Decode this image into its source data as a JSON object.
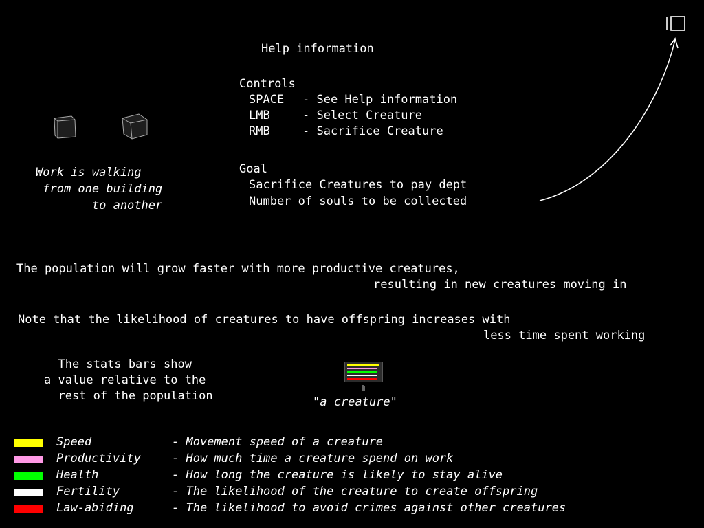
{
  "help": {
    "title": "Help information",
    "controls_heading": "Controls",
    "controls": [
      {
        "key": "SPACE",
        "desc": "- See Help information"
      },
      {
        "key": "LMB",
        "desc": "- Select Creature"
      },
      {
        "key": "RMB",
        "desc": "- Sacrifice Creature"
      }
    ],
    "goal_heading": "Goal",
    "goal_lines": [
      "Sacrifice Creatures to pay dept",
      "Number of souls to be collected"
    ]
  },
  "work_note": {
    "lines": [
      "Work is walking",
      " from one building",
      "        to another"
    ]
  },
  "population": {
    "line1": "The population will grow faster with more productive creatures,",
    "line2": "resulting in new creatures moving in"
  },
  "offspring_note": {
    "line1": "Note that the likelihood of creatures to have offspring increases with",
    "line2": "less time spent working"
  },
  "stats_note": {
    "lines": [
      "  The stats bars show",
      "a value relative to the",
      "  rest of the population"
    ]
  },
  "creature_label": "\"a creature\"",
  "legend": [
    {
      "name": "Speed",
      "desc": "- Movement speed of a creature",
      "color": "#ffff00"
    },
    {
      "name": "Productivity",
      "desc": "- How much time a creature spend on work",
      "color": "#ff99e6"
    },
    {
      "name": "Health",
      "desc": "- How long the creature is likely to stay alive",
      "color": "#00ff00"
    },
    {
      "name": "Fertility",
      "desc": "- The likelihood of the creature to create offspring",
      "color": "#ffffff"
    },
    {
      "name": "Law-abiding",
      "desc": "- The likelihood to avoid crimes against other creatures",
      "color": "#ff0000"
    }
  ],
  "creature_bars": [
    {
      "stat": "Speed",
      "value": 0.95,
      "color": "#ffff00"
    },
    {
      "stat": "Productivity",
      "value": 0.9,
      "color": "#ff99e6"
    },
    {
      "stat": "Health",
      "value": 0.9,
      "color": "#00ff00"
    },
    {
      "stat": "Fertility",
      "value": 0.9,
      "color": "#ffffff"
    },
    {
      "stat": "Law-abiding",
      "value": 0.9,
      "color": "#ff0000"
    }
  ],
  "icons": {
    "building_1": "building-cube-icon",
    "building_2": "building-cube-icon",
    "menu": "souls-counter-icon",
    "arrow": "curved-arrow-icon"
  }
}
